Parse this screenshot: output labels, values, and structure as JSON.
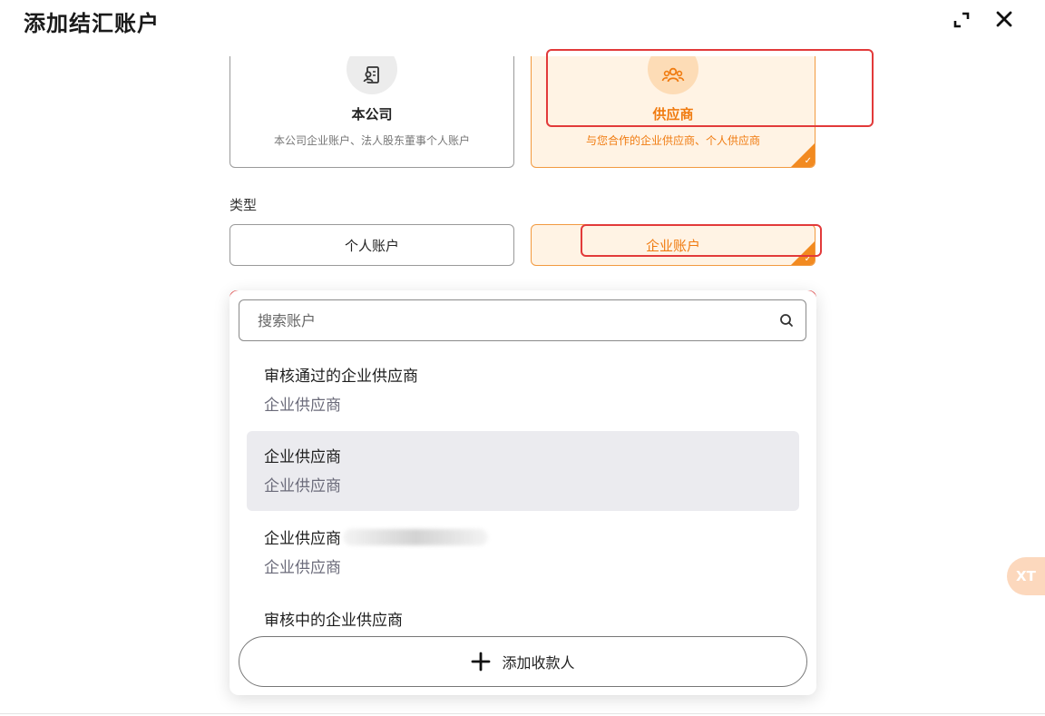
{
  "dialog": {
    "title": "添加结汇账户"
  },
  "owner_cards": [
    {
      "icon": "document-person-icon",
      "title": "本公司",
      "desc": "本公司企业账户、法人股东董事个人账户",
      "selected": false
    },
    {
      "icon": "group-users-icon",
      "title": "供应商",
      "desc": "与您合作的企业供应商、个人供应商",
      "selected": true
    }
  ],
  "type_section": {
    "label": "类型",
    "options": [
      {
        "label": "个人账户",
        "selected": false
      },
      {
        "label": "企业账户",
        "selected": true
      }
    ]
  },
  "dropdown": {
    "search_placeholder": "搜索账户",
    "items": [
      {
        "name": "审核通过的企业供应商",
        "sub": "企业供应商",
        "highlighted": false
      },
      {
        "name": "企业供应商",
        "sub": "企业供应商",
        "highlighted": true
      },
      {
        "name": "企业供应商",
        "sub": "企业供应商",
        "highlighted": false,
        "redacted": true
      },
      {
        "name": "审核中的企业供应商",
        "sub": "",
        "highlighted": false
      }
    ],
    "add_button_label": "添加收款人"
  },
  "floating_bubble": {
    "label": "XT"
  },
  "colors": {
    "accent": "#f07b10",
    "accent_bg": "#fff3e4",
    "highlight_red": "#e23a3a",
    "row_hover": "#ebebef"
  }
}
